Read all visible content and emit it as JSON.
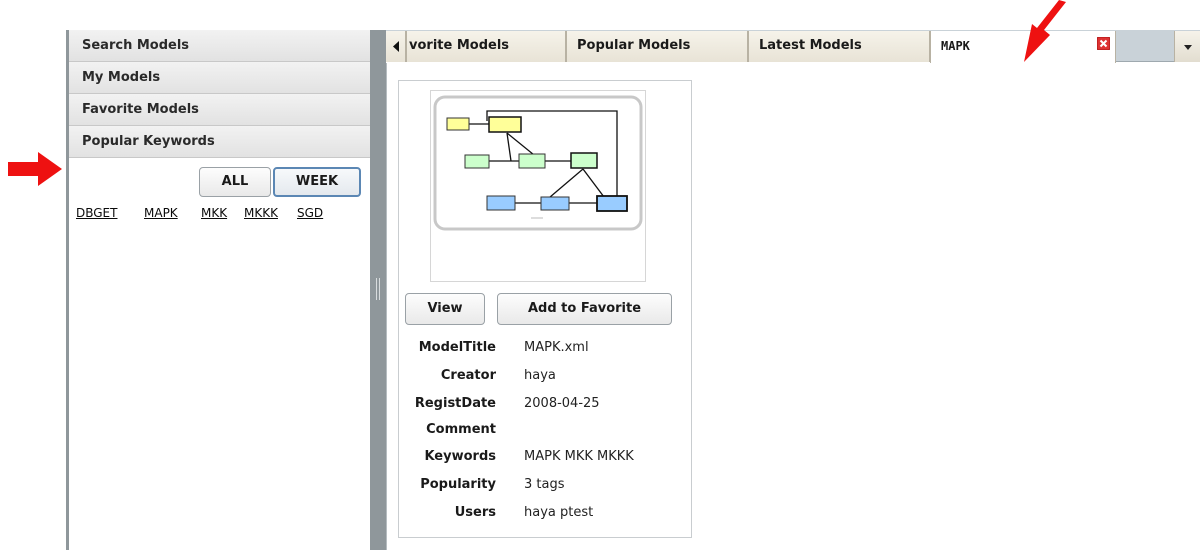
{
  "left_panel": {
    "sections": [
      {
        "label": "Search Models"
      },
      {
        "label": "My Models"
      },
      {
        "label": "Favorite Models"
      },
      {
        "label": "Popular Keywords"
      }
    ],
    "period_buttons": {
      "all": "ALL",
      "week": "WEEK",
      "selected": "WEEK"
    },
    "keywords": [
      "DBGET",
      "MAPK",
      "MKK",
      "MKKK",
      "SGD"
    ]
  },
  "tabs": {
    "scroll_left_icon": "triangle-left-icon",
    "items": [
      {
        "label": "vorite Models"
      },
      {
        "label": "Popular Models"
      },
      {
        "label": "Latest Models"
      },
      {
        "label": "MAPK"
      }
    ],
    "active": "MAPK",
    "menu_icon": "chevron-down-icon"
  },
  "model": {
    "buttons": {
      "view": "View",
      "favorite": "Add to Favorite"
    },
    "fields": [
      {
        "label": "ModelTitle",
        "value": "MAPK.xml"
      },
      {
        "label": "Creator",
        "value": "haya"
      },
      {
        "label": "RegistDate",
        "value": "2008-04-25"
      },
      {
        "label": "Comment",
        "value": ""
      },
      {
        "label": "Keywords",
        "value": "MAPK MKK MKKK"
      },
      {
        "label": "Popularity",
        "value": "3 tags"
      },
      {
        "label": "Users",
        "value": "haya ptest"
      }
    ]
  },
  "colors": {
    "node_yellow": "#ffff99",
    "node_green": "#ccffcc",
    "node_blue": "#99ccff",
    "annotation_red": "#ee1111",
    "close_red": "#dd3333"
  }
}
